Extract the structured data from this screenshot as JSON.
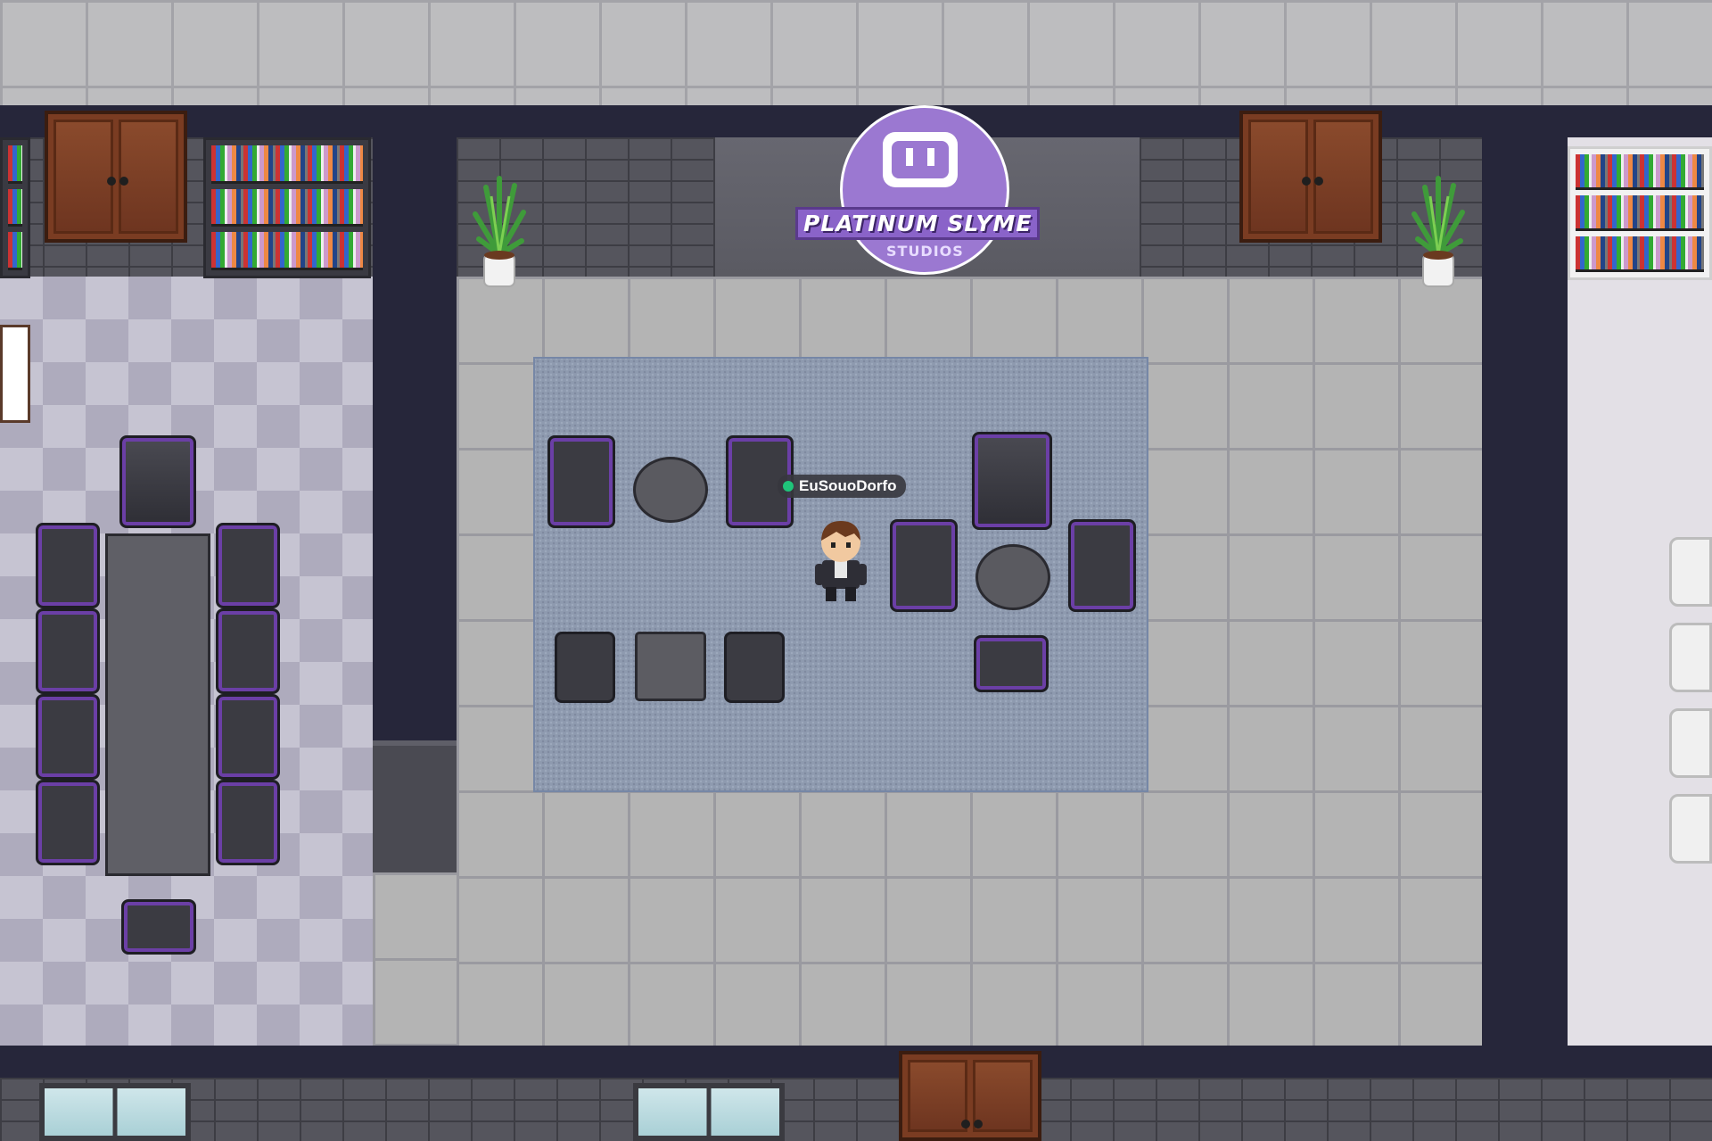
{
  "map": {
    "theme_color": "#9b78d1",
    "logo": {
      "title": "PLATINUM SLYME",
      "subtitle": "STUDIOS"
    },
    "player": {
      "name": "EuSouoDorfo",
      "status_color": "#1fc47a"
    }
  }
}
